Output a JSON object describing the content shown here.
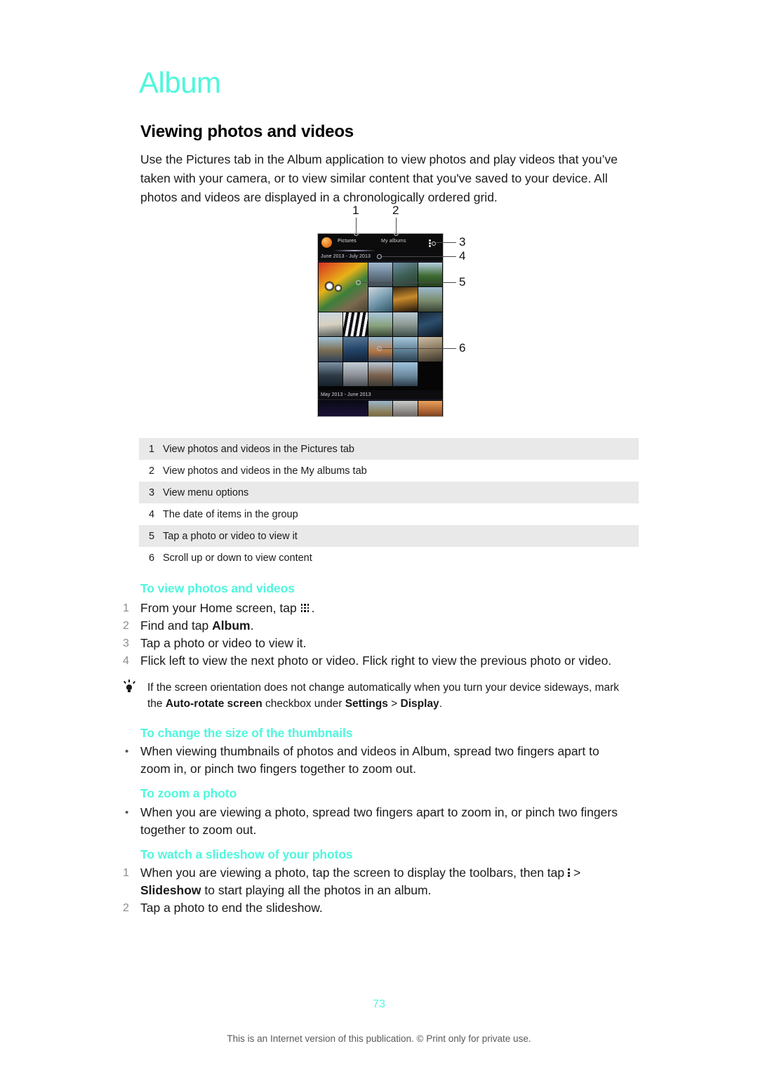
{
  "document": {
    "chapter_title": "Album",
    "section_title": "Viewing photos and videos",
    "intro": "Use the Pictures tab in the Album application to view photos and play videos that you’ve taken with your camera, or to view similar content that you've saved to your device. All photos and videos are displayed in a chronologically ordered grid.",
    "page_number": "73",
    "footer_note": "This is an Internet version of this publication. © Print only for private use."
  },
  "colors": {
    "accent_cyan": "#4ff7dd",
    "table_alt_row": "#e9e9e9",
    "body_text": "#1a1a1a",
    "step_number": "#8c8c8c"
  },
  "figure": {
    "callouts": [
      "1",
      "2",
      "3",
      "4",
      "5",
      "6"
    ],
    "phone_screen": {
      "tabs": [
        {
          "label": "Pictures",
          "selected": true
        },
        {
          "label": "My albums",
          "selected": false
        }
      ],
      "menu_icon": "overflow-menu-icon",
      "app_icon": "album-app-icon",
      "groups": [
        {
          "date_label": "June 2013 - July 2013"
        },
        {
          "date_label": "May 2013 - June 2013"
        }
      ]
    }
  },
  "legend": {
    "rows": [
      {
        "num": "1",
        "text": "View photos and videos in the Pictures tab"
      },
      {
        "num": "2",
        "text": "View photos and videos in the My albums tab"
      },
      {
        "num": "3",
        "text": "View menu options"
      },
      {
        "num": "4",
        "text": "The date of items in the group"
      },
      {
        "num": "5",
        "text": "Tap a photo or video to view it"
      },
      {
        "num": "6",
        "text": "Scroll up or down to view content"
      }
    ]
  },
  "procedures": [
    {
      "heading": "To view photos and videos",
      "steps": [
        {
          "num": "1",
          "prefix": "From your Home screen, tap ",
          "icon": "app-drawer-icon",
          "suffix": "."
        },
        {
          "num": "2",
          "prefix": "Find and tap ",
          "bold": "Album",
          "suffix": "."
        },
        {
          "num": "3",
          "prefix": "Tap a photo or video to view it."
        },
        {
          "num": "4",
          "prefix": "Flick left to view the next photo or video. Flick right to view the previous photo or video."
        }
      ]
    },
    {
      "heading": "To change the size of the thumbnails",
      "bullets": [
        "When viewing thumbnails of photos and videos in Album, spread two fingers apart to zoom in, or pinch two fingers together to zoom out."
      ]
    },
    {
      "heading": "To zoom a photo",
      "bullets": [
        "When you are viewing a photo, spread two fingers apart to zoom in, or pinch two fingers together to zoom out."
      ]
    },
    {
      "heading": "To watch a slideshow of your photos",
      "steps": [
        {
          "num": "1",
          "prefix": "When you are viewing a photo, tap the screen to display the toolbars, then tap ",
          "icon": "overflow-menu-icon",
          "mid": "> ",
          "bold": "Slideshow",
          "suffix": " to start playing all the photos in an album."
        },
        {
          "num": "2",
          "prefix": "Tap a photo to end the slideshow."
        }
      ]
    }
  ],
  "tip": {
    "icon": "lightbulb-icon",
    "part1": "If the screen orientation does not change automatically when you turn your device sideways, mark the ",
    "bold1": "Auto-rotate screen",
    "part2": " checkbox under ",
    "bold2": "Settings",
    "part3": " > ",
    "bold3": "Display",
    "part4": "."
  }
}
